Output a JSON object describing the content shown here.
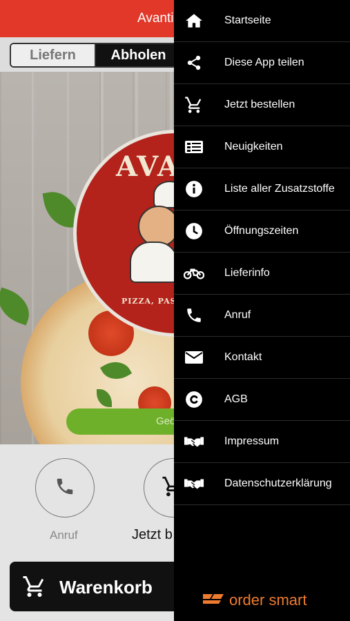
{
  "app": {
    "header_title": "Avanti",
    "tabs": [
      "Liefern",
      "Abholen"
    ],
    "logo_text": "AVA",
    "logo_sub": "PIZZA, PASTA ,",
    "locate_button": "Geö",
    "quick_actions": [
      {
        "label": "Anruf",
        "icon": "phone-icon"
      },
      {
        "label": "Jetzt b",
        "icon": "cart-icon"
      }
    ],
    "cart_label": "Warenkorb"
  },
  "drawer": {
    "items": [
      {
        "label": "Startseite",
        "icon": "home-icon"
      },
      {
        "label": "Diese App teilen",
        "icon": "share-icon"
      },
      {
        "label": "Jetzt bestellen",
        "icon": "cart-icon"
      },
      {
        "label": "Neuigkeiten",
        "icon": "news-icon"
      },
      {
        "label": "Liste aller Zusatzstoffe",
        "icon": "info-icon"
      },
      {
        "label": "Öffnungszeiten",
        "icon": "clock-icon"
      },
      {
        "label": "Lieferinfo",
        "icon": "motorcycle-icon"
      },
      {
        "label": "Anruf",
        "icon": "phone-icon"
      },
      {
        "label": "Kontakt",
        "icon": "envelope-icon"
      },
      {
        "label": "AGB",
        "icon": "copyright-icon"
      },
      {
        "label": "Impressum",
        "icon": "handshake-icon"
      },
      {
        "label": "Datenschutzerklärung",
        "icon": "handshake-icon"
      }
    ],
    "brand": "order smart"
  },
  "colors": {
    "header_red": "#e2382a",
    "drawer_bg": "#000000",
    "accent_green": "#6fb02b",
    "brand_orange": "#ee7b2f"
  }
}
